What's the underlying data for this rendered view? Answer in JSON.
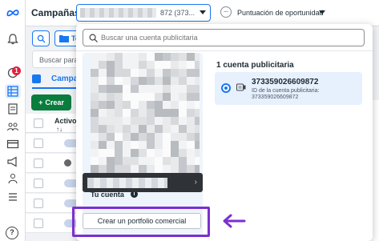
{
  "header": {
    "title": "Campañas",
    "account_selector": {
      "id_fragment": "872 (373..."
    },
    "opportunity": {
      "icon": "minus-circle-icon",
      "label": "Puntuación de oportunidad"
    }
  },
  "sidebar": {
    "badge_count": "1",
    "icons": [
      "meta-logo-icon",
      "bell-icon",
      "chat-icon",
      "grid-icon",
      "document-icon",
      "people-icon",
      "card-icon",
      "megaphone-icon",
      "audience-icon",
      "menu-icon",
      "help-icon"
    ],
    "help_label": "?"
  },
  "background": {
    "folder_button_label": "To",
    "search_placeholder": "Buscar para fi",
    "campaigns_tab_label": "Campa",
    "create_button_label": "Crear",
    "create_button_prefix": "+",
    "table_header_active": "Activo",
    "table_header_sort": "↑↓"
  },
  "dropdown": {
    "search_placeholder": "Buscar una cuenta publicitaria",
    "your_account_label": "Tu cuenta",
    "info_icon": "i",
    "account_card_chevron": "›",
    "accounts_count_label": "1 cuenta publicitaria",
    "account": {
      "name": "373359026609872",
      "id_label": "ID de la cuenta publicitaria:",
      "id_value": "373359026609872",
      "selected": true
    },
    "create_portfolio_label": "Crear un portfolio comercial"
  },
  "colors": {
    "accent": "#1877f2",
    "highlight": "#7b2fd0",
    "create_green": "#0a7d3e",
    "badge_red": "#e41e3f"
  }
}
